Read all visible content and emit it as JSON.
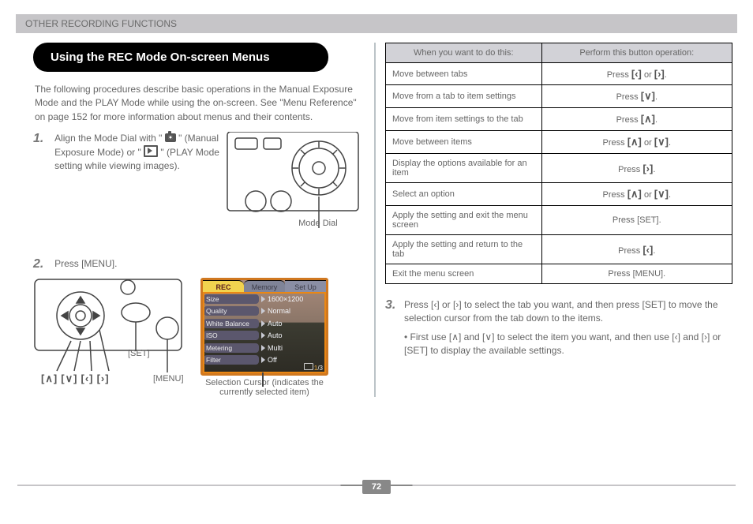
{
  "header": {
    "breadcrumb": "OTHER RECORDING FUNCTIONS"
  },
  "section": {
    "title": "Using the REC Mode On-screen Menus",
    "intro": "The following procedures describe basic operations in the Manual Exposure Mode and the PLAY Mode while using the on-screen. See \"Menu Reference\" on page 152 for more information about menus and their contents."
  },
  "steps": [
    {
      "n": "1.",
      "text_a": "Align the Mode Dial with \"",
      "text_b": "\" (Manual Exposure Mode) or \"",
      "text_c": "\" (PLAY Mode setting while viewing images)."
    },
    {
      "n": "2.",
      "text": "Press [MENU]."
    }
  ],
  "figure_labels": {
    "mode_dial": "Mode Dial",
    "set": "[SET]",
    "menu": "[MENU]",
    "arrows": "[∧] [∨] [‹] [›]",
    "selection_cursor": "Selection Cursor (indicates the currently selected item)"
  },
  "screen": {
    "tabs": [
      "REC",
      "Memory",
      "Set Up"
    ],
    "rows": [
      {
        "label": "Size",
        "value": "1600×1200"
      },
      {
        "label": "Quality",
        "value": "Normal"
      },
      {
        "label": "White Balance",
        "value": "Auto"
      },
      {
        "label": "ISO",
        "value": "Auto"
      },
      {
        "label": "Metering",
        "value": "Multi"
      },
      {
        "label": "Filter",
        "value": "Off"
      }
    ],
    "pager": "1/3"
  },
  "table": {
    "head": [
      "When you want to do this:",
      "Perform this button operation:"
    ],
    "rows": [
      [
        "Move between tabs",
        "Press [‹] or [›]."
      ],
      [
        "Move from a tab to item settings",
        "Press [∨]."
      ],
      [
        "Move from item settings to the tab",
        "Press [∧]."
      ],
      [
        "Move between items",
        "Press [∧] or [∨]."
      ],
      [
        "Display the options available for an item",
        "Press [›]."
      ],
      [
        "Select an option",
        "Press [∧] or [∨]."
      ],
      [
        "Apply the setting and exit the menu screen",
        "Press [SET]."
      ],
      [
        "Apply the setting and return to the tab",
        "Press [‹]."
      ],
      [
        "Exit the menu screen",
        "Press [MENU]."
      ]
    ]
  },
  "last_step": {
    "n": "3.",
    "text_a": "Press [‹] or [›] to select the tab you want, and then press [SET] to move the selection cursor from the tab down to the items.",
    "bullet": "• First use [∧] and [∨] to select the item you want, and then use [‹] and [›] or [SET] to display the available settings."
  },
  "page_number": "72"
}
